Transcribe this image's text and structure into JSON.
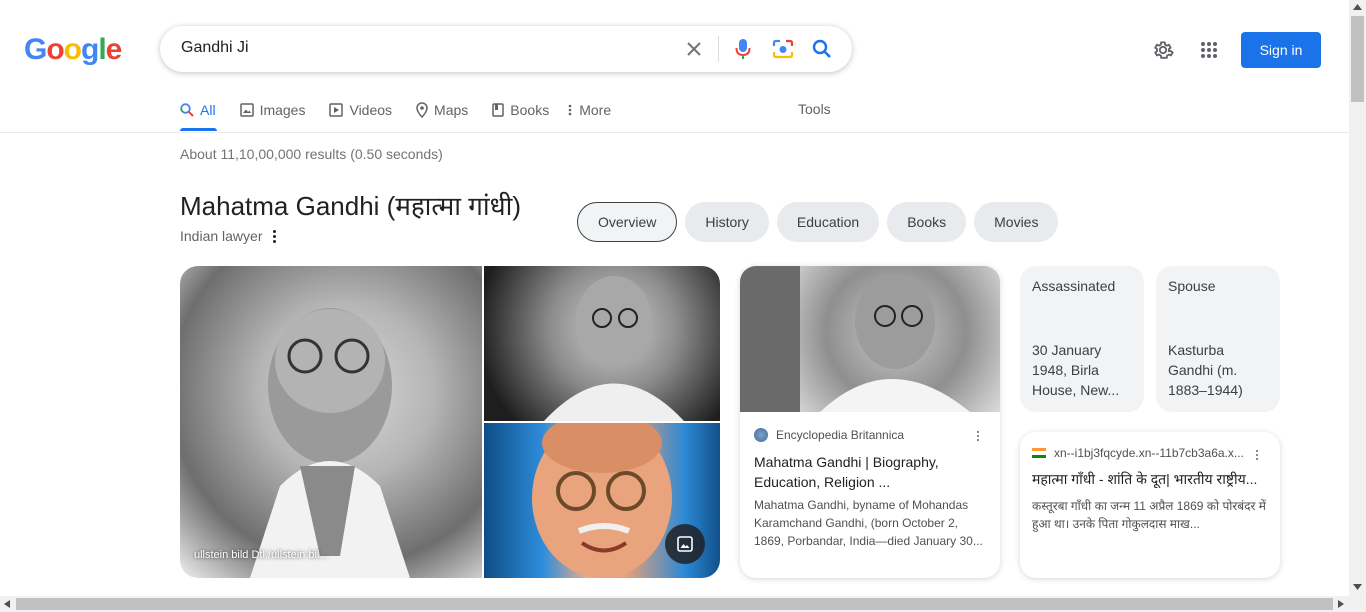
{
  "logo": {
    "letters": [
      "G",
      "o",
      "o",
      "g",
      "l",
      "e"
    ],
    "colors": [
      "#4285F4",
      "#EA4335",
      "#FBBC05",
      "#4285F4",
      "#34A853",
      "#EA4335"
    ]
  },
  "search": {
    "query": "Gandhi Ji"
  },
  "header": {
    "signin_label": "Sign in",
    "accent": "#1a73e8"
  },
  "tabs": [
    {
      "label": "All",
      "icon": "search-icon",
      "active": true
    },
    {
      "label": "Images",
      "icon": "image-icon"
    },
    {
      "label": "Videos",
      "icon": "play-icon"
    },
    {
      "label": "Maps",
      "icon": "map-pin-icon"
    },
    {
      "label": "Books",
      "icon": "book-icon"
    },
    {
      "label": "More",
      "icon": "more-vert-icon"
    }
  ],
  "tools_label": "Tools",
  "results_stats": "About 11,10,00,000 results (0.50 seconds)",
  "knowledge_panel": {
    "title": "Mahatma Gandhi (महात्मा गांधी)",
    "subtitle": "Indian lawyer",
    "chips": [
      "Overview",
      "History",
      "Education",
      "Books",
      "Movies"
    ],
    "image_caption": "ullstein bild Dtl./ullstein bil..."
  },
  "britannica": {
    "source": "Encyclopedia Britannica",
    "title": "Mahatma Gandhi | Biography, Education, Religion ...",
    "snippet": "Mahatma Gandhi, byname of Mohandas Karamchand Gandhi, (born October 2, 1869, Porbandar, India—died January 30..."
  },
  "facts": [
    {
      "label": "Assassinated",
      "value": "30 January 1948, Birla House, New..."
    },
    {
      "label": "Spouse",
      "value": "Kasturba Gandhi (m. 1883–1944)"
    }
  ],
  "hindi_result": {
    "source": "xn--i1bj3fqcyde.xn--11b7cb3a6a.x...",
    "title": "महात्मा गाँधी - शांति के दूत| भारतीय राष्ट्रीय...",
    "snippet": "कस्तूरबा गाँधी का जन्म 11 अप्रैल 1869 को पोरबंदर में हुआ था। उनके पिता गोकुलदास माख..."
  }
}
